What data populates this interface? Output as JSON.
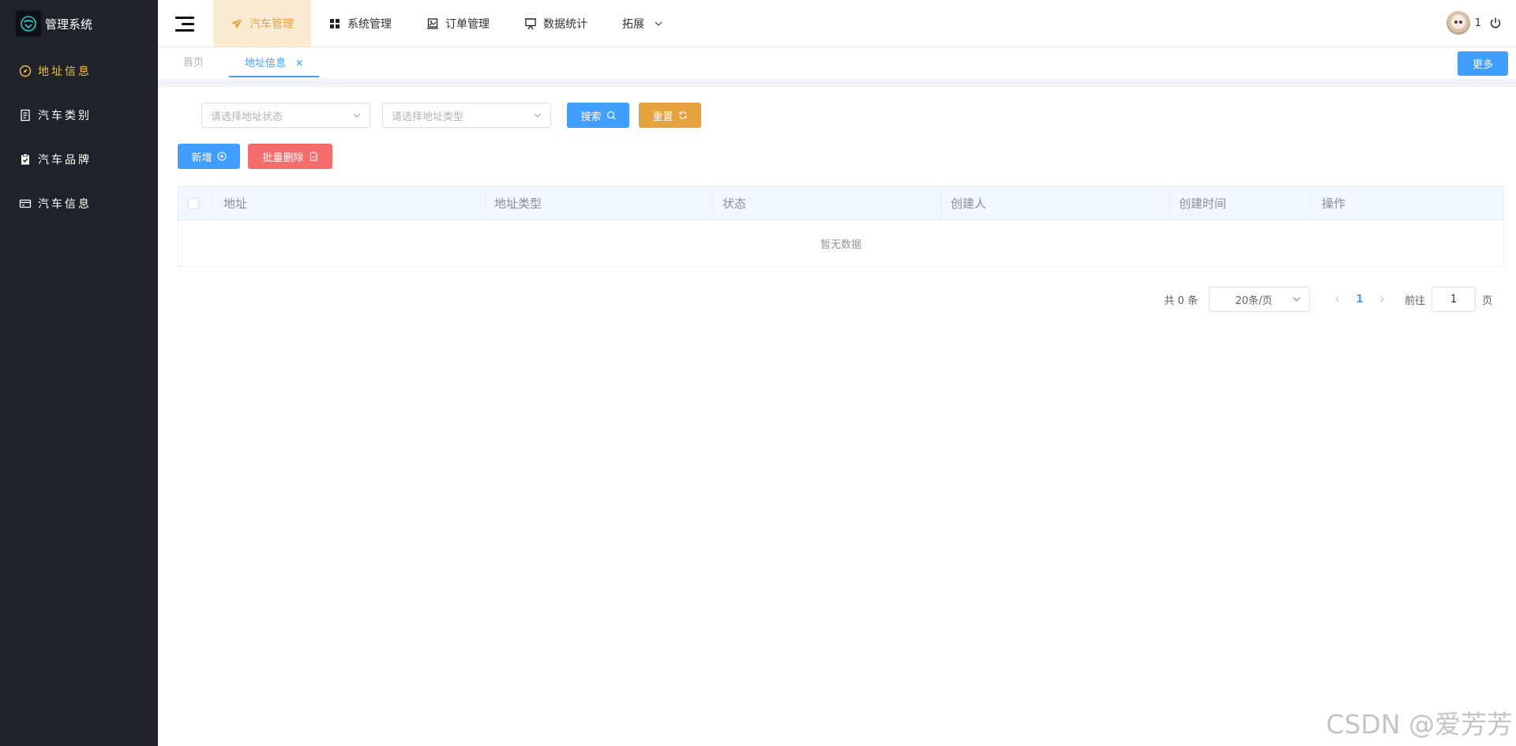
{
  "brand": {
    "title": "管理系统"
  },
  "sidebar": {
    "items": [
      {
        "label": "地址信息",
        "icon": "compass-icon",
        "active": true
      },
      {
        "label": "汽车类别",
        "icon": "document-icon",
        "active": false
      },
      {
        "label": "汽车品牌",
        "icon": "clipboard-check-icon",
        "active": false
      },
      {
        "label": "汽车信息",
        "icon": "credit-card-icon",
        "active": false
      }
    ]
  },
  "topnav": {
    "items": [
      {
        "label": "汽车管理",
        "icon": "paper-plane-icon",
        "active": true
      },
      {
        "label": "系统管理",
        "icon": "grid-icon",
        "active": false
      },
      {
        "label": "订单管理",
        "icon": "picture-icon",
        "active": false
      },
      {
        "label": "数据统计",
        "icon": "presentation-icon",
        "active": false
      },
      {
        "label": "拓展",
        "icon": "chevron-down-icon",
        "active": false
      }
    ]
  },
  "user": {
    "name": "1"
  },
  "tags": {
    "home": "首页",
    "active": "地址信息",
    "more_label": "更多"
  },
  "filters": {
    "status_placeholder": "请选择地址状态",
    "type_placeholder": "请选择地址类型",
    "search_label": "搜索",
    "reset_label": "重置"
  },
  "actions": {
    "add_label": "新增",
    "batch_delete_label": "批量删除"
  },
  "table": {
    "columns": [
      "地址",
      "地址类型",
      "状态",
      "创建人",
      "创建时间",
      "操作"
    ],
    "empty_text": "暂无数据"
  },
  "pagination": {
    "total": "共 0 条",
    "page_size": "20条/页",
    "current_page": "1",
    "goto_label": "前往",
    "goto_value": "1",
    "page_unit": "页"
  },
  "watermark": "CSDN @爱芳芳",
  "colors": {
    "sidebar_bg": "#1f2329",
    "sidebar_active": "#f0c13a",
    "primary": "#409eff",
    "warning": "#e6a23c",
    "danger": "#f56c6c",
    "nav_active_bg": "#fcebd3"
  }
}
